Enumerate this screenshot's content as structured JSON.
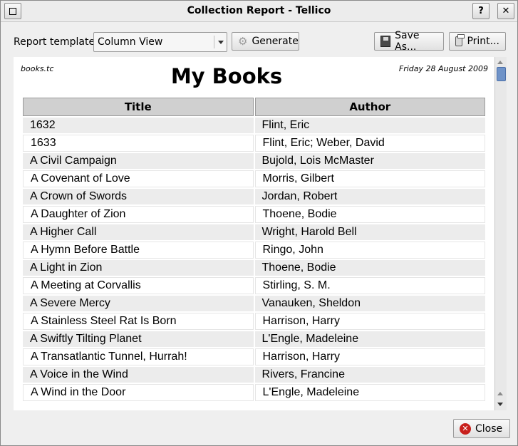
{
  "window": {
    "title": "Collection Report - Tellico",
    "help_label": "?",
    "close_glyph": "✕"
  },
  "toolbar": {
    "template_label": "Report template:",
    "template_value": "Column View",
    "generate_label": "Generate",
    "saveas_label": "Save As...",
    "print_label": "Print..."
  },
  "report": {
    "filename": "books.tc",
    "title": "My Books",
    "date": "Friday 28 August 2009",
    "columns": [
      "Title",
      "Author"
    ],
    "rows": [
      [
        "1632",
        "Flint, Eric"
      ],
      [
        "1633",
        "Flint, Eric; Weber, David"
      ],
      [
        "A Civil Campaign",
        "Bujold, Lois McMaster"
      ],
      [
        "A Covenant of Love",
        "Morris, Gilbert"
      ],
      [
        "A Crown of Swords",
        "Jordan, Robert"
      ],
      [
        "A Daughter of Zion",
        "Thoene, Bodie"
      ],
      [
        "A Higher Call",
        "Wright, Harold Bell"
      ],
      [
        "A Hymn Before Battle",
        "Ringo, John"
      ],
      [
        "A Light in Zion",
        "Thoene, Bodie"
      ],
      [
        "A Meeting at Corvallis",
        "Stirling, S. M."
      ],
      [
        "A Severe Mercy",
        "Vanauken, Sheldon"
      ],
      [
        "A Stainless Steel Rat Is Born",
        "Harrison, Harry"
      ],
      [
        "A Swiftly Tilting Planet",
        "L'Engle, Madeleine"
      ],
      [
        "A Transatlantic Tunnel, Hurrah!",
        "Harrison, Harry"
      ],
      [
        "A Voice in the Wind",
        "Rivers, Francine"
      ],
      [
        "A Wind in the Door",
        "L'Engle, Madeleine"
      ]
    ]
  },
  "footer": {
    "close_label": "Close"
  }
}
